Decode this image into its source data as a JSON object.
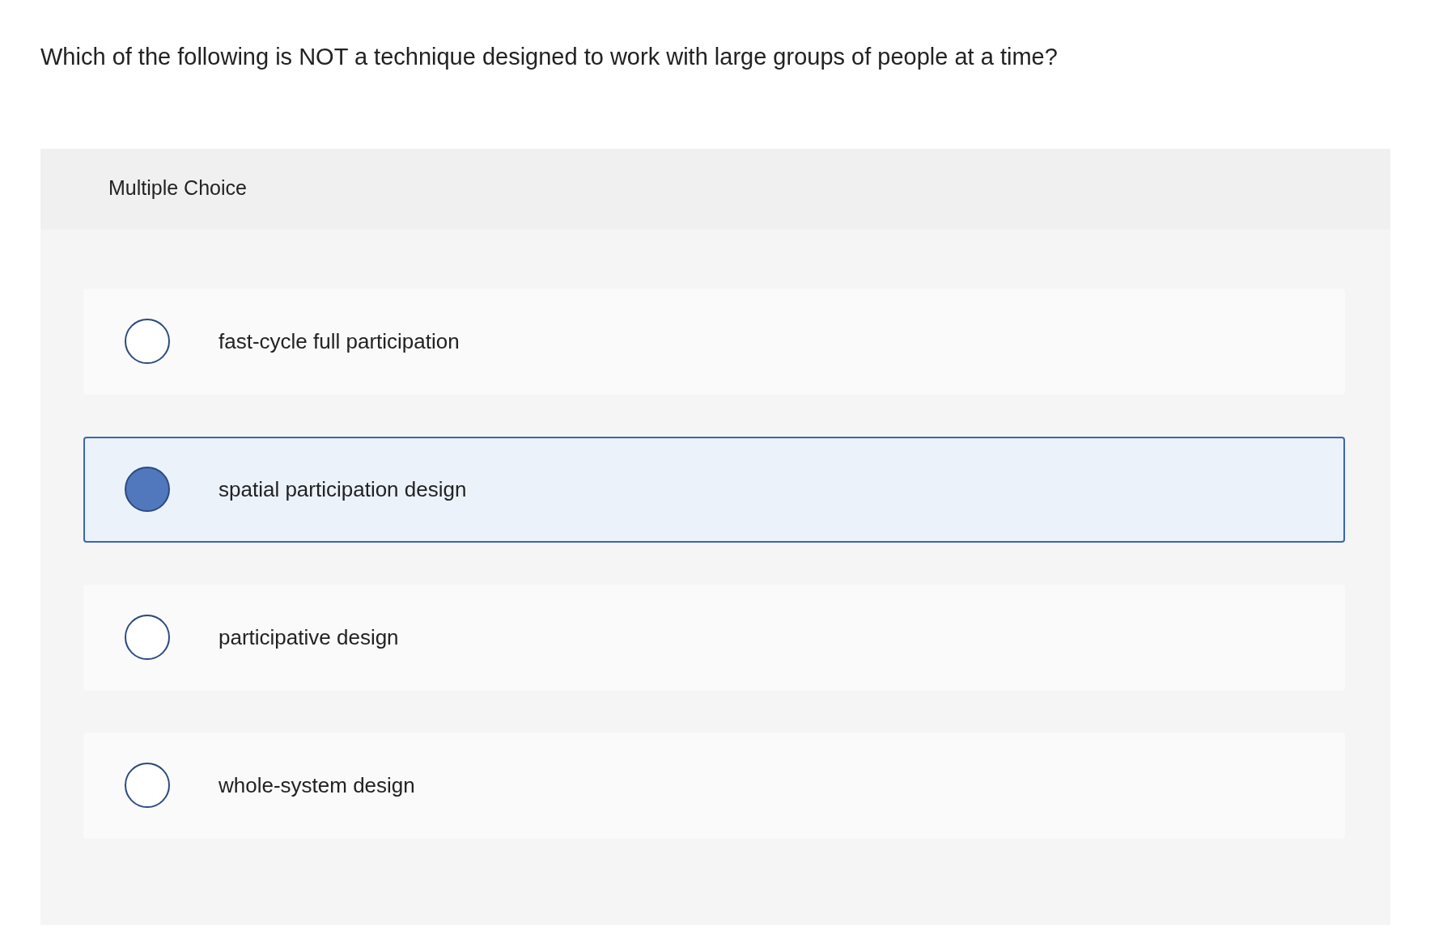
{
  "question": "Which of the following is NOT a technique designed to work with large groups of people at a time?",
  "panel": {
    "title": "Multiple Choice",
    "options": [
      {
        "label": "fast-cycle full participation",
        "selected": false
      },
      {
        "label": "spatial participation design",
        "selected": true
      },
      {
        "label": "participative design",
        "selected": false
      },
      {
        "label": "whole-system design",
        "selected": false
      }
    ]
  }
}
